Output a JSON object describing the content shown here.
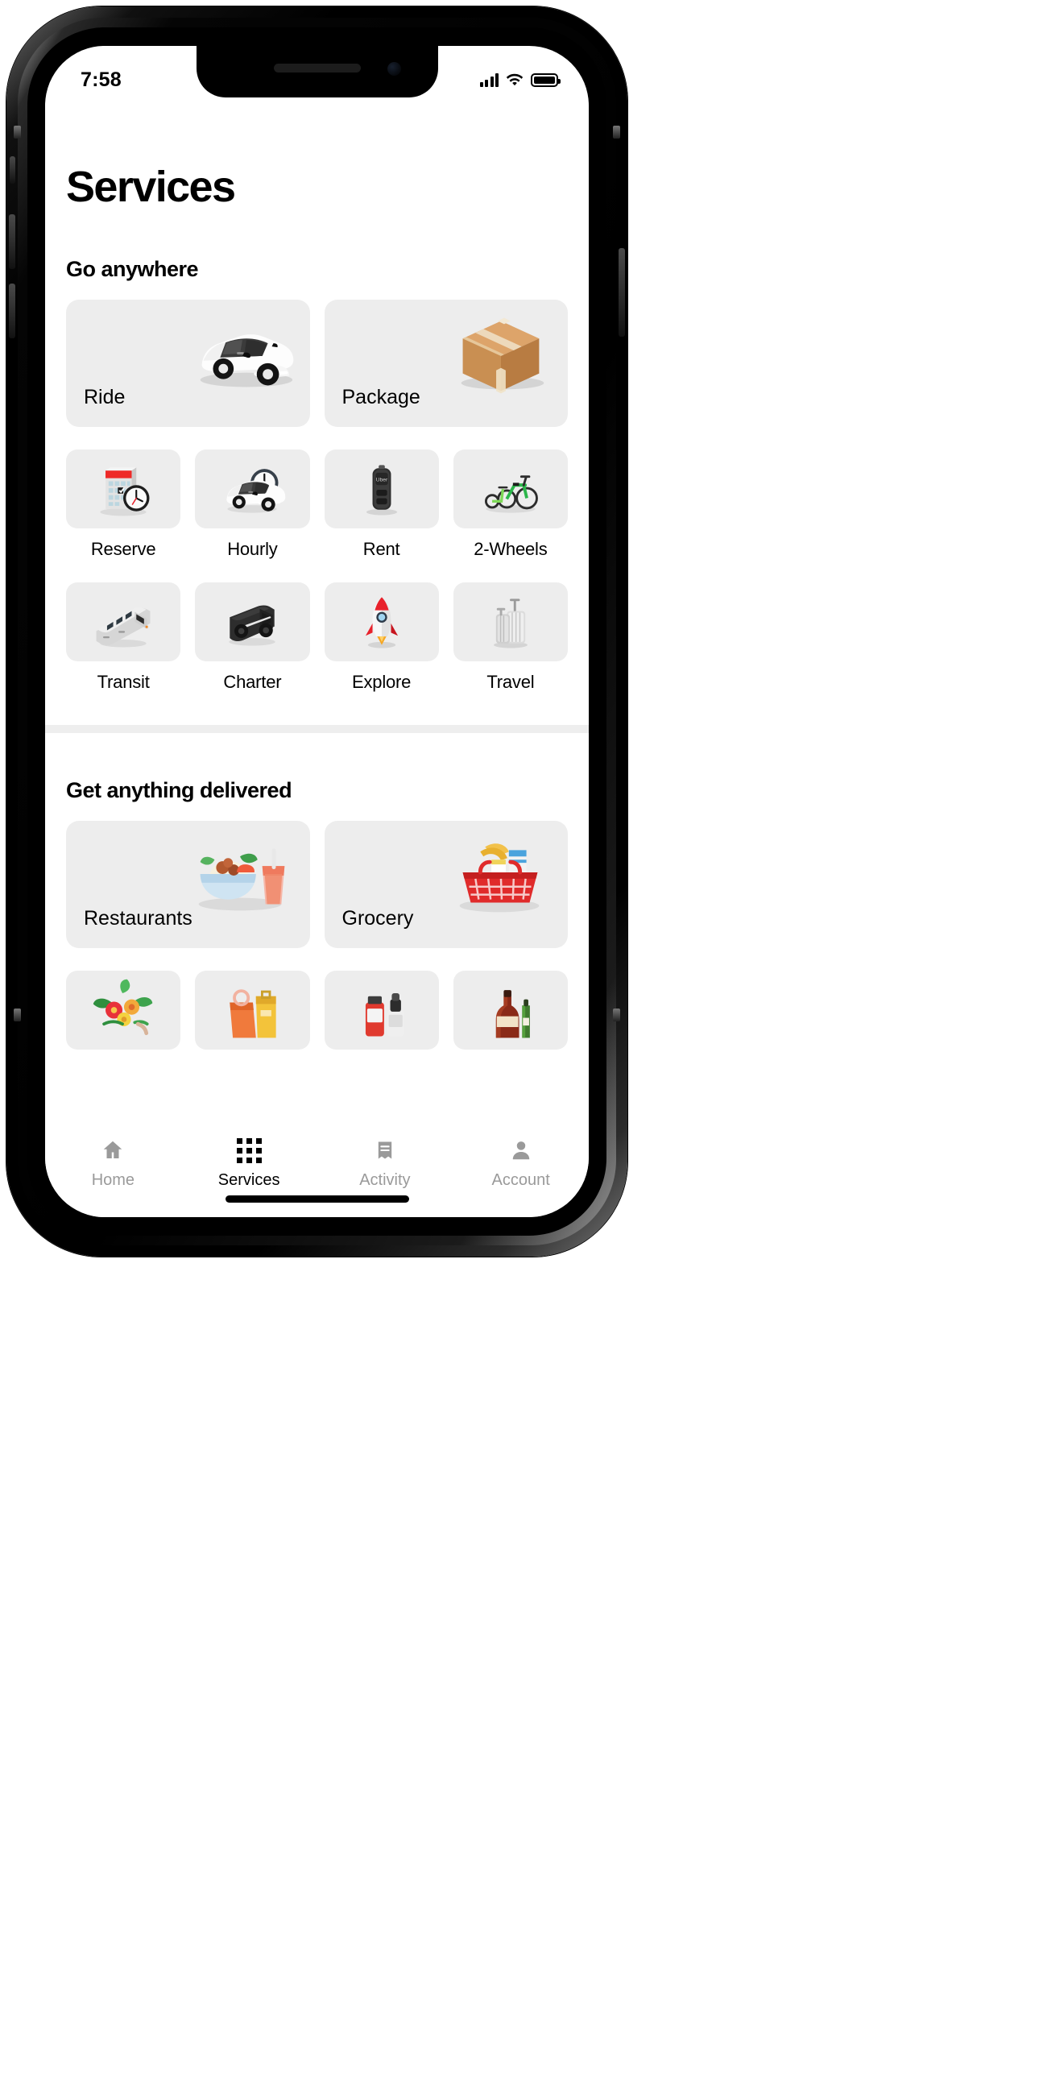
{
  "status_bar": {
    "time": "7:58",
    "signal_icon": "cellular-signal-icon",
    "wifi_icon": "wifi-icon",
    "battery_icon": "battery-full-icon"
  },
  "header": {
    "title": "Services"
  },
  "sections": [
    {
      "id": "go-anywhere",
      "heading": "Go anywhere",
      "wide_cards": [
        {
          "label": "Ride",
          "icon": "white-car-icon"
        },
        {
          "label": "Package",
          "icon": "cardboard-box-icon"
        }
      ],
      "tiles": [
        {
          "label": "Reserve",
          "icon": "calendar-clock-icon"
        },
        {
          "label": "Hourly",
          "icon": "car-clock-icon"
        },
        {
          "label": "Rent",
          "icon": "car-key-fob-icon"
        },
        {
          "label": "2-Wheels",
          "icon": "bike-scooter-icon"
        },
        {
          "label": "Transit",
          "icon": "tram-icon"
        },
        {
          "label": "Charter",
          "icon": "charter-van-icon"
        },
        {
          "label": "Explore",
          "icon": "rocket-icon"
        },
        {
          "label": "Travel",
          "icon": "suitcase-icon"
        }
      ]
    },
    {
      "id": "get-anything-delivered",
      "heading": "Get anything delivered",
      "wide_cards": [
        {
          "label": "Restaurants",
          "icon": "food-bowl-drink-icon"
        },
        {
          "label": "Grocery",
          "icon": "grocery-basket-icon"
        }
      ],
      "tiles": [
        {
          "label": "",
          "icon": "flowers-icon"
        },
        {
          "label": "",
          "icon": "retail-bag-icon"
        },
        {
          "label": "",
          "icon": "pharmacy-icon"
        },
        {
          "label": "",
          "icon": "alcohol-bottle-icon"
        }
      ]
    }
  ],
  "tabbar": {
    "items": [
      {
        "label": "Home",
        "icon": "home-icon",
        "active": false
      },
      {
        "label": "Services",
        "icon": "grid-icon",
        "active": true
      },
      {
        "label": "Activity",
        "icon": "receipt-icon",
        "active": false
      },
      {
        "label": "Account",
        "icon": "person-icon",
        "active": false
      }
    ]
  },
  "colors": {
    "card_bg": "#ededed",
    "divider": "#eeeeee",
    "accent_red": "#e8212b",
    "inactive_tab": "#9a9a9a",
    "active_tab": "#000000"
  }
}
